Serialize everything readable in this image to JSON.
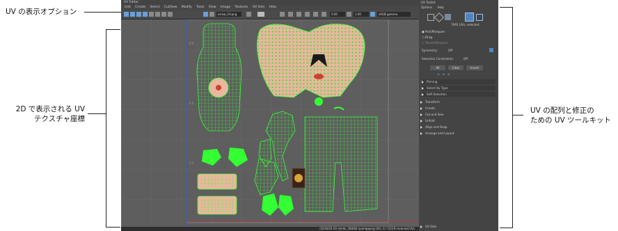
{
  "callouts": {
    "display_options": "UV の表示オプション",
    "uv_2d_line1": "2D で表示される UV",
    "uv_2d_line2": "テクスチャ座標",
    "toolkit_line1": "UV の配列と修正の",
    "toolkit_line2": "ための UV ツールキット"
  },
  "uv_editor": {
    "title": "UV Editor",
    "menu": [
      "Edit",
      "Create",
      "Select",
      "Cut/Sew",
      "Modify",
      "Tools",
      "View",
      "Image",
      "Textures",
      "UV Sets",
      "Help"
    ],
    "texture_field": "arrow_UV.png",
    "value_field_1": "0.00",
    "value_field_2": "1.00",
    "channel_field": "sRGB gamma",
    "status_text": "(1616/16 UV shells, 284/64 overlapping UVs, 0 / 15/19 reversed UVs"
  },
  "uv_toolkit": {
    "title": "UV Toolkit",
    "menu": [
      "Options",
      "Help"
    ],
    "selection_label": "7091 UVs: selected",
    "radio_1": "Pick/Marquee",
    "radio_2": "Drag",
    "radio_3": "Tweak/Marquee",
    "symmetry_label": "Symmetry:",
    "symmetry_value": "Off",
    "constraints_label": "Selection Constraints:",
    "constraints_value": "Off",
    "btn_all": "All",
    "btn_clear": "Clear",
    "btn_invert": "Invert",
    "subsections": [
      "Pinning",
      "Select By Type",
      "Soft Selection"
    ],
    "sections": [
      "Transform",
      "Create",
      "Cut and Sew",
      "Unfold",
      "Align and Snap",
      "Arrange and Layout"
    ],
    "footer": "UV Sets"
  }
}
